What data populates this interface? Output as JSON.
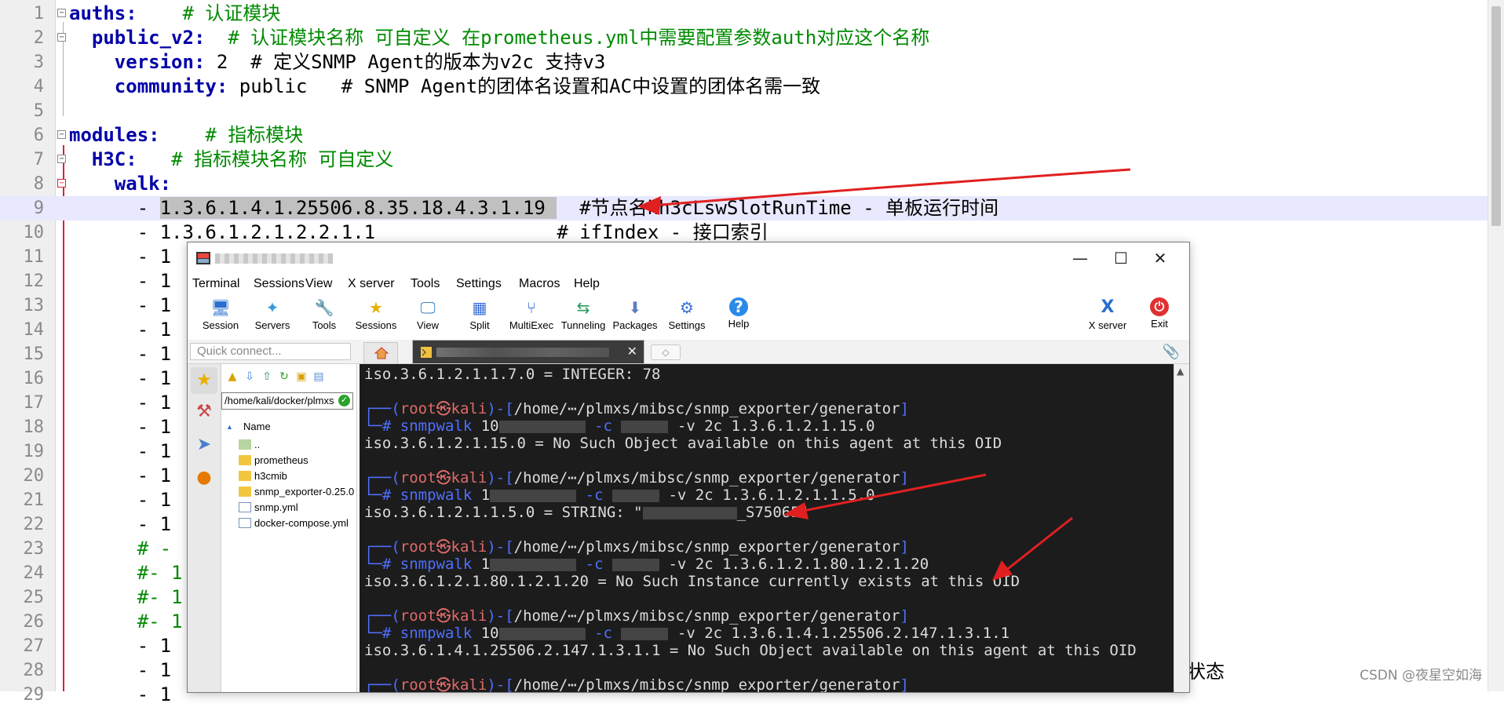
{
  "editor": {
    "lines": [
      {
        "n": "1",
        "fold": "minus",
        "parts": [
          [
            "k",
            "auths:"
          ],
          [
            "t",
            "    "
          ],
          [
            "c",
            "# 认证模块"
          ]
        ]
      },
      {
        "n": "2",
        "fold": "minus",
        "parts": [
          [
            "t",
            "  "
          ],
          [
            "k",
            "public_v2:"
          ],
          [
            "t",
            "  "
          ],
          [
            "c",
            "# 认证模块名称 可自定义 在prometheus.yml中需要配置参数auth对应这个名称"
          ]
        ]
      },
      {
        "n": "3",
        "fold": "",
        "parts": [
          [
            "t",
            "    "
          ],
          [
            "k",
            "version:"
          ],
          [
            "t",
            " 2  # 定义SNMP Agent的版本为v2c 支持v3"
          ]
        ]
      },
      {
        "n": "4",
        "fold": "",
        "parts": [
          [
            "t",
            "    "
          ],
          [
            "k",
            "community:"
          ],
          [
            "t",
            " public   # SNMP Agent的团体名设置和AC中设置的团体名需一致"
          ]
        ]
      },
      {
        "n": "5",
        "fold": "",
        "parts": []
      },
      {
        "n": "6",
        "fold": "minus",
        "parts": [
          [
            "k",
            "modules:"
          ],
          [
            "t",
            "    "
          ],
          [
            "c",
            "# 指标模块"
          ]
        ]
      },
      {
        "n": "7",
        "fold": "minus",
        "parts": [
          [
            "t",
            "  "
          ],
          [
            "k",
            "H3C:"
          ],
          [
            "t",
            "   "
          ],
          [
            "c",
            "# 指标模块名称 可自定义"
          ]
        ]
      },
      {
        "n": "8",
        "fold": "red",
        "parts": [
          [
            "t",
            "    "
          ],
          [
            "k",
            "walk:"
          ]
        ]
      },
      {
        "n": "9",
        "fold": "",
        "hl": true,
        "parts": [
          [
            "t",
            "      - "
          ],
          [
            "s",
            "1.3.6.1.4.1.25506.8.35.18.4.3.1.19 "
          ],
          [
            "t",
            "  #节点名hh3cLswSlotRunTime - 单板运行时间"
          ]
        ]
      },
      {
        "n": "10",
        "fold": "",
        "parts": [
          [
            "t",
            "      - 1.3.6.1.2.1.2.2.1.1                # ifIndex - 接口索引"
          ]
        ]
      },
      {
        "n": "11",
        "fold": "",
        "parts": [
          [
            "t",
            "      - 1"
          ]
        ]
      },
      {
        "n": "12",
        "fold": "",
        "parts": [
          [
            "t",
            "      - 1"
          ]
        ]
      },
      {
        "n": "13",
        "fold": "",
        "parts": [
          [
            "t",
            "      - 1"
          ]
        ]
      },
      {
        "n": "14",
        "fold": "",
        "parts": [
          [
            "t",
            "      - 1"
          ]
        ]
      },
      {
        "n": "15",
        "fold": "",
        "parts": [
          [
            "t",
            "      - 1"
          ]
        ]
      },
      {
        "n": "16",
        "fold": "",
        "parts": [
          [
            "t",
            "      - 1"
          ]
        ]
      },
      {
        "n": "17",
        "fold": "",
        "parts": [
          [
            "t",
            "      - 1"
          ]
        ]
      },
      {
        "n": "18",
        "fold": "",
        "parts": [
          [
            "t",
            "      - 1"
          ]
        ]
      },
      {
        "n": "19",
        "fold": "",
        "parts": [
          [
            "t",
            "      - 1"
          ]
        ]
      },
      {
        "n": "20",
        "fold": "",
        "parts": [
          [
            "t",
            "      - 1"
          ]
        ]
      },
      {
        "n": "21",
        "fold": "",
        "parts": [
          [
            "t",
            "      - 1"
          ]
        ]
      },
      {
        "n": "22",
        "fold": "",
        "parts": [
          [
            "t",
            "      - 1"
          ]
        ]
      },
      {
        "n": "23",
        "fold": "",
        "parts": [
          [
            "t",
            "      "
          ],
          [
            "c",
            "# -"
          ]
        ]
      },
      {
        "n": "24",
        "fold": "",
        "parts": [
          [
            "t",
            "      "
          ],
          [
            "c",
            "#- 1"
          ]
        ]
      },
      {
        "n": "25",
        "fold": "",
        "parts": [
          [
            "t",
            "      "
          ],
          [
            "c",
            "#- 1"
          ]
        ]
      },
      {
        "n": "26",
        "fold": "",
        "parts": [
          [
            "t",
            "      "
          ],
          [
            "c",
            "#- 1"
          ]
        ]
      },
      {
        "n": "27",
        "fold": "",
        "parts": [
          [
            "t",
            "      - 1"
          ]
        ]
      },
      {
        "n": "28",
        "fold": "",
        "parts": [
          [
            "t",
            "      - 1"
          ]
        ]
      },
      {
        "n": "29",
        "fold": "",
        "parts": [
          [
            "t",
            "      - 1"
          ]
        ]
      }
    ],
    "behind_text": "状态"
  },
  "moba": {
    "menus": [
      "Terminal",
      "Sessions",
      "View",
      "X server",
      "Tools",
      "Settings",
      "Macros",
      "Help"
    ],
    "toolbar": [
      {
        "label": "Session",
        "icon": "session-icon",
        "glyph": "🖥"
      },
      {
        "label": "Servers",
        "icon": "servers-icon",
        "glyph": "✦"
      },
      {
        "label": "Tools",
        "icon": "tools-icon",
        "glyph": "🔧"
      },
      {
        "label": "Sessions",
        "icon": "sessions-icon",
        "glyph": "★"
      },
      {
        "label": "View",
        "icon": "view-icon",
        "glyph": "🖵"
      },
      {
        "label": "Split",
        "icon": "split-icon",
        "glyph": "▦"
      },
      {
        "label": "MultiExec",
        "icon": "multiexec-icon",
        "glyph": "⑂"
      },
      {
        "label": "Tunneling",
        "icon": "tunneling-icon",
        "glyph": "⇆"
      },
      {
        "label": "Packages",
        "icon": "packages-icon",
        "glyph": "⬇"
      },
      {
        "label": "Settings",
        "icon": "settings-icon",
        "glyph": "⚙"
      },
      {
        "label": "Help",
        "icon": "help-icon",
        "glyph": "?"
      }
    ],
    "toolbar_right": [
      {
        "label": "X server",
        "icon": "x-server-icon",
        "glyph": "X"
      },
      {
        "label": "Exit",
        "icon": "exit-icon",
        "glyph": "⏻"
      }
    ],
    "quick_connect_placeholder": "Quick connect...",
    "file_path": "/home/kali/docker/plmxs",
    "file_header": "Name",
    "files": [
      {
        "name": "..",
        "kind": "updir"
      },
      {
        "name": "prometheus",
        "kind": "folder"
      },
      {
        "name": "h3cmib",
        "kind": "folder"
      },
      {
        "name": "snmp_exporter-0.25.0",
        "kind": "folder"
      },
      {
        "name": "snmp.yml",
        "kind": "file"
      },
      {
        "name": "docker-compose.yml",
        "kind": "file"
      }
    ],
    "terminal": [
      {
        "type": "out",
        "text": "iso.3.6.1.2.1.1.7.0 = INTEGER: 78"
      },
      {
        "type": "blank"
      },
      {
        "type": "prompt",
        "user": "root",
        "host": "kali",
        "path": "/home/⋯/plmxs/mibsc/snmp_exporter/generator"
      },
      {
        "type": "cmd",
        "pre": "snmpwalk",
        "a": "10",
        "b": "-c",
        "c": "-v 2c 1.3.6.1.2.1.15.0"
      },
      {
        "type": "out",
        "text": "iso.3.6.1.2.1.15.0 = No Such Object available on this agent at this OID"
      },
      {
        "type": "blank"
      },
      {
        "type": "prompt",
        "user": "root",
        "host": "kali",
        "path": "/home/⋯/plmxs/mibsc/snmp_exporter/generator"
      },
      {
        "type": "cmd",
        "pre": "snmpwalk",
        "a": "1",
        "b": "-c",
        "c": "-v 2c 1.3.6.1.2.1.1.5.0"
      },
      {
        "type": "out",
        "text": "iso.3.6.1.2.1.1.5.0 = STRING: \"",
        "tail": "_S7506E\""
      },
      {
        "type": "blank"
      },
      {
        "type": "prompt",
        "user": "root",
        "host": "kali",
        "path": "/home/⋯/plmxs/mibsc/snmp_exporter/generator"
      },
      {
        "type": "cmd",
        "pre": "snmpwalk",
        "a": "1",
        "b": "-c",
        "c": "-v 2c 1.3.6.1.2.1.80.1.2.1.20"
      },
      {
        "type": "out",
        "text": "iso.3.6.1.2.1.80.1.2.1.20 = No Such Instance currently exists at this OID"
      },
      {
        "type": "blank"
      },
      {
        "type": "prompt",
        "user": "root",
        "host": "kali",
        "path": "/home/⋯/plmxs/mibsc/snmp_exporter/generator"
      },
      {
        "type": "cmd",
        "pre": "snmpwalk",
        "a": "10",
        "b": "-c",
        "c": "-v 2c 1.3.6.1.4.1.25506.2.147.1.3.1.1"
      },
      {
        "type": "out",
        "text": "iso.3.6.1.4.1.25506.2.147.1.3.1.1 = No Such Object available on this agent at this OID"
      },
      {
        "type": "blank"
      },
      {
        "type": "prompt",
        "user": "root",
        "host": "kali",
        "path": "/home/⋯/plmxs/mibsc/snmp_exporter/generator"
      }
    ]
  },
  "watermark": "CSDN @夜星空如海",
  "colors": {
    "arrow": "#e02020",
    "keyword": "#0000a8",
    "comment": "#008a00"
  }
}
